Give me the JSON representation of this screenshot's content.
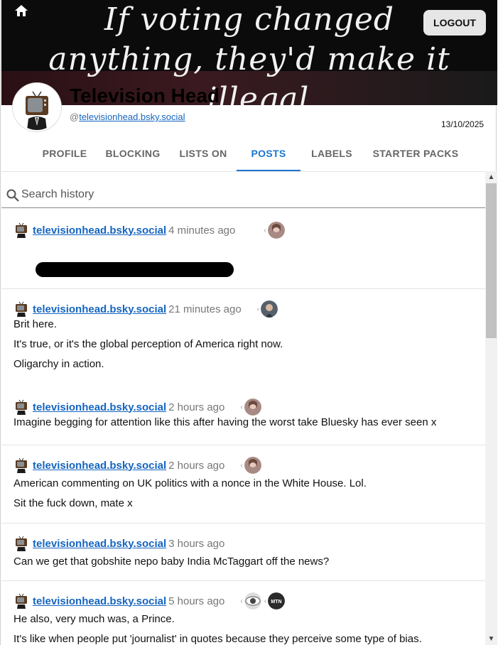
{
  "banner": {
    "line1": "If voting changed",
    "line2": "anything, they'd make it",
    "line3": "illegal."
  },
  "header": {
    "logout_label": "LOGOUT"
  },
  "profile": {
    "display_name": "Television Head",
    "handle_prefix": "@",
    "handle": "televisionhead.bsky.social",
    "date": "13/10/2025"
  },
  "tabs": [
    {
      "label": "PROFILE"
    },
    {
      "label": "BLOCKING"
    },
    {
      "label": "LISTS ON"
    },
    {
      "label": "POSTS"
    },
    {
      "label": "LABELS"
    },
    {
      "label": "STARTER PACKS"
    }
  ],
  "active_tab": "POSTS",
  "search": {
    "placeholder": "Search history"
  },
  "posts": [
    {
      "handle": "televisionhead.bsky.social",
      "time": "4 minutes ago",
      "lines": [],
      "redacted": true
    },
    {
      "handle": "televisionhead.bsky.social",
      "time": "21 minutes ago",
      "lines": [
        "Brit here.",
        "It's true, or it's the global perception of America right now.",
        "Oligarchy in action."
      ]
    },
    {
      "handle": "televisionhead.bsky.social",
      "time": "2 hours ago",
      "lines": [
        "Imagine begging for attention like this after having the worst take Bluesky has ever seen x"
      ]
    },
    {
      "handle": "televisionhead.bsky.social",
      "time": "2 hours ago",
      "lines": [
        "American commenting on UK politics with a nonce in the White House. Lol.",
        "Sit the fuck down, mate x"
      ]
    },
    {
      "handle": "televisionhead.bsky.social",
      "time": "3 hours ago",
      "lines": [
        "Can we get that gobshite nepo baby India McTaggart off the news?"
      ]
    },
    {
      "handle": "televisionhead.bsky.social",
      "time": "5 hours ago",
      "lines": [
        "He also, very much was, a Prince.",
        "It's like when people put 'journalist' in quotes because they perceive some type of bias."
      ],
      "reply_badge": "MTN"
    }
  ],
  "colors": {
    "accent": "#1976d2",
    "link": "#1565c0",
    "banner_bg": "#0b0b0b"
  }
}
